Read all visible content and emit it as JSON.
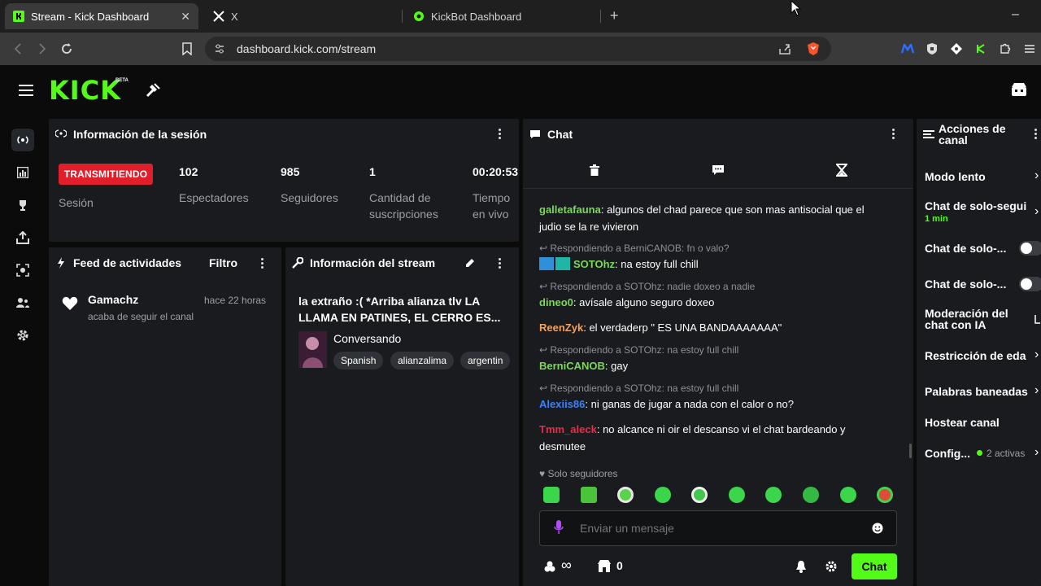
{
  "browser": {
    "tabs": [
      {
        "title": "Stream - Kick Dashboard",
        "active": true
      },
      {
        "title": "X",
        "active": false
      },
      {
        "title": "KickBot Dashboard",
        "active": false
      }
    ],
    "url": "dashboard.kick.com/stream",
    "new_tab": "+",
    "window_min": "–"
  },
  "app": {
    "logo": "KICK",
    "logo_badge": "BETA"
  },
  "session": {
    "title": "Información de la sesión",
    "status": "TRANSMITIENDO",
    "status_label": "Sesión",
    "stats": [
      {
        "value": "102",
        "label": "Espectadores"
      },
      {
        "value": "985",
        "label": "Seguidores"
      },
      {
        "value": "1",
        "label_line1": "Cantidad de",
        "label_line2": "suscripciones"
      },
      {
        "value": "00:20:53",
        "label_line1": "Tiempo",
        "label_line2": "en vivo"
      }
    ]
  },
  "feed": {
    "title": "Feed de actividades",
    "filter": "Filtro",
    "items": [
      {
        "user": "Gamachz",
        "time": "hace 22 horas",
        "desc": "acaba de seguir el canal"
      }
    ]
  },
  "stream_info": {
    "title": "Información del stream",
    "stream_title_line1": "la extraño :( *Arriba alianza tlv LA",
    "stream_title_line2": "LLAMA EN PATINES, EL CERRO ES...",
    "category": "Conversando",
    "tags": [
      "Spanish",
      "alianzalima",
      "argentin"
    ]
  },
  "chat": {
    "title": "Chat",
    "messages": [
      {
        "user": "galletafauna",
        "color": "#7bd957",
        "text_line1": "algunos del chad parece que son mas antisocial que el",
        "text_line2": "judio se la re vivieron"
      },
      {
        "reply": "Respondiendo a BerniCANOB: fn o valo?",
        "user": "SOTOhz",
        "color": "#7bd957",
        "text": "na estoy full chill"
      },
      {
        "reply": "Respondiendo a SOTOhz: nadie doxeo a nadie",
        "user": "dineo0",
        "color": "#7bd957",
        "text": "avísale alguno seguro doxeo"
      },
      {
        "user": "ReenZyk",
        "color": "#f5a15b",
        "text": "el verdaderp \" ES UNA BANDAAAAAAA\""
      },
      {
        "reply": "Respondiendo a SOTOhz: na estoy full chill",
        "user": "BerniCANOB",
        "color": "#7bd957",
        "text": "gay"
      },
      {
        "reply": "Respondiendo a SOTOhz: na estoy full chill",
        "user": "Alexiis86",
        "color": "#3b82f6",
        "text": "ni ganas de jugar a nada con el calor o no?"
      },
      {
        "user": "Tmm_aleck",
        "color": "#e0304a",
        "text_line1": "no alcance ni oir el descanso vi el chat bardeando y",
        "text_line2": "desmutee"
      }
    ],
    "mode": "Solo seguidores",
    "input_placeholder": "Enviar un mensaje",
    "points": "0",
    "send": "Chat",
    "infinity": "∞"
  },
  "actions": {
    "title_line1": "Acciones de",
    "title_line2": "canal",
    "items": [
      {
        "label": "Modo lento"
      },
      {
        "label": "Chat de solo-segui",
        "sub": "1 min"
      },
      {
        "label": "Chat de solo-..."
      },
      {
        "label": "Chat de solo-..."
      },
      {
        "label_line1": "Moderación del",
        "label_line2": "chat con IA"
      },
      {
        "label": "Restricción de eda"
      },
      {
        "label": "Palabras baneadas"
      },
      {
        "label": "Hostear canal"
      },
      {
        "label": "Config...",
        "sub": "2 activas"
      }
    ]
  },
  "colors": {
    "kick_green": "#53fc18",
    "live_red": "#e01f2b",
    "panel": "#191b1f"
  }
}
